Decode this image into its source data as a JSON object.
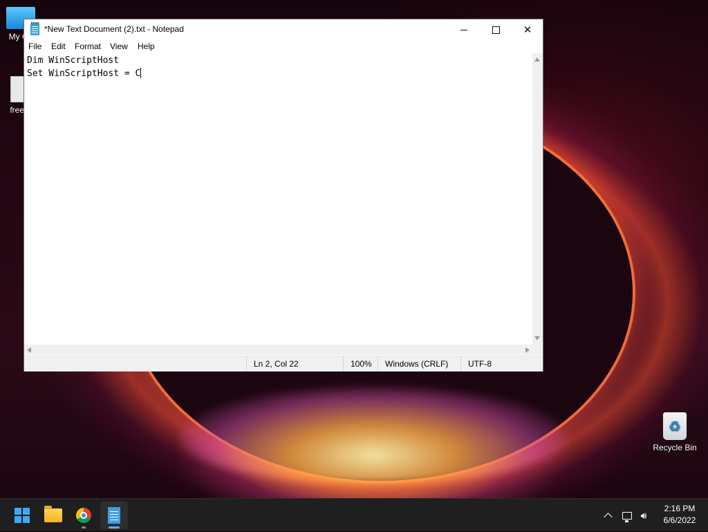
{
  "desktop": {
    "icons": [
      {
        "label": "My Co"
      },
      {
        "label": "freero"
      },
      {
        "label": "Recycle Bin"
      }
    ]
  },
  "notepad": {
    "title": "*New Text Document (2).txt - Notepad",
    "menu": [
      "File",
      "Edit",
      "Format",
      "View",
      "Help"
    ],
    "content_lines": [
      "Dim WinScriptHost",
      "Set WinScriptHost = C"
    ],
    "status": {
      "position": "Ln 2, Col 22",
      "zoom": "100%",
      "line_endings": "Windows (CRLF)",
      "encoding": "UTF-8"
    }
  },
  "taskbar": {
    "apps": [
      {
        "name": "start-icon"
      },
      {
        "name": "file-explorer-icon"
      },
      {
        "name": "chrome-icon"
      },
      {
        "name": "notepad-icon"
      }
    ],
    "clock": {
      "time": "2:16 PM",
      "date": "6/6/2022"
    }
  },
  "colors": {
    "accent": "#3fa9f5",
    "taskbar": "#1f1f1f"
  }
}
